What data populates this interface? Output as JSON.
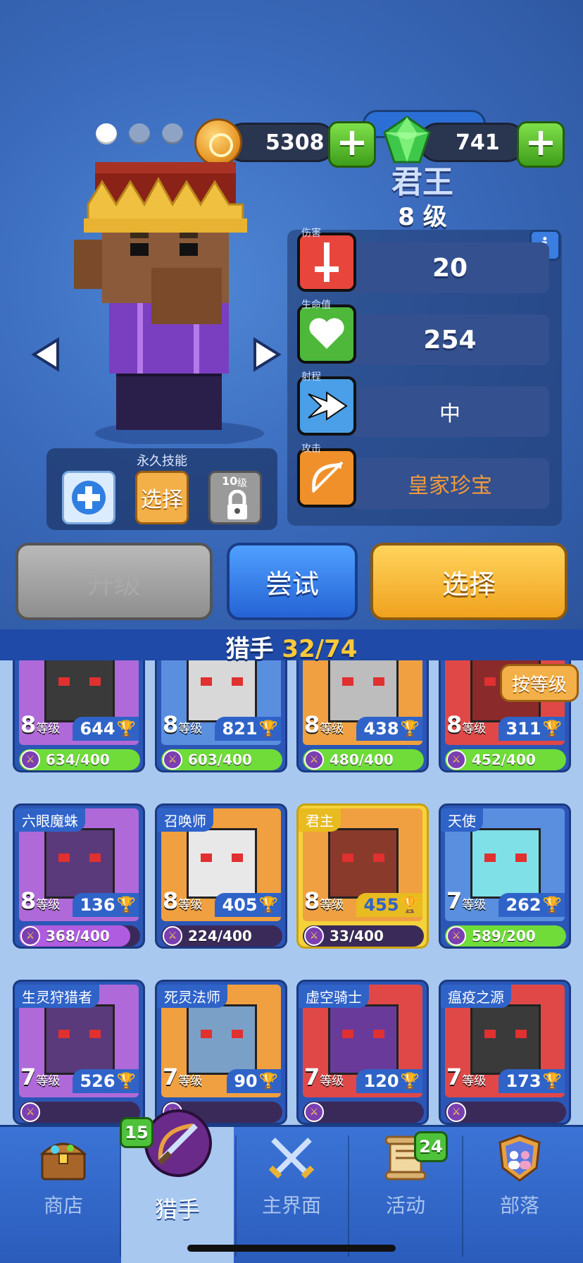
{
  "currency": {
    "coins": "5308",
    "gems": "741",
    "coin_icon": "gold-coin-icon",
    "gem_icon": "green-gem-icon"
  },
  "hero": {
    "name": "君王",
    "level": "8 级"
  },
  "stats": [
    {
      "label": "伤害",
      "value": "20",
      "icon": "sword-icon",
      "color": "#e8453c"
    },
    {
      "label": "生命值",
      "value": "254",
      "icon": "heart-icon",
      "color": "#4db83a"
    },
    {
      "label": "射程",
      "value": "中",
      "icon": "range-arrows-icon",
      "color": "#4a9fe8"
    },
    {
      "label": "攻击",
      "value": "皇家珍宝",
      "icon": "bow-arrow-icon",
      "color": "#f0902a"
    }
  ],
  "permanent_skill": {
    "title": "永久技能",
    "select_label": "选择",
    "locked_level": "10",
    "locked_level_unit": "级"
  },
  "buttons": {
    "upgrade": "升级",
    "try": "尝试",
    "select": "选择"
  },
  "hunters": {
    "title": "猎手",
    "count": "32/74",
    "sort_label": "按等级"
  },
  "cards": [
    {
      "name": "",
      "level": "8",
      "level_unit": "等级",
      "trophies": "644",
      "progress": "634/400",
      "fraction": 1.0,
      "art": "#b069d8",
      "accent": "#3a3a3a"
    },
    {
      "name": "",
      "level": "8",
      "level_unit": "等级",
      "trophies": "821",
      "progress": "603/400",
      "fraction": 1.0,
      "art": "#5a8fe0",
      "accent": "#d8d8d8"
    },
    {
      "name": "",
      "level": "8",
      "level_unit": "等级",
      "trophies": "438",
      "progress": "480/400",
      "fraction": 1.0,
      "art": "#f0a040",
      "accent": "#bdbdbd"
    },
    {
      "name": "",
      "level": "8",
      "level_unit": "等级",
      "trophies": "311",
      "progress": "452/400",
      "fraction": 1.0,
      "art": "#e04848",
      "accent": "#8a2a2a"
    },
    {
      "name": "六眼魔蛛",
      "level": "8",
      "level_unit": "等级",
      "trophies": "136",
      "progress": "368/400",
      "fraction": 0.92,
      "art": "#b069d8",
      "accent": "#5a3a7a"
    },
    {
      "name": "召唤师",
      "level": "8",
      "level_unit": "等级",
      "trophies": "405",
      "progress": "224/400",
      "fraction": 0.0,
      "art": "#f0a040",
      "accent": "#e8e8e8"
    },
    {
      "name": "君主",
      "level": "8",
      "level_unit": "等级",
      "trophies": "455",
      "progress": "33/400",
      "fraction": 0.0,
      "art": "#f0a040",
      "accent": "#8a3a2a",
      "selected": true
    },
    {
      "name": "天使",
      "level": "7",
      "level_unit": "等级",
      "trophies": "262",
      "progress": "589/200",
      "fraction": 1.0,
      "art": "#5a8fe0",
      "accent": "#7fe0e8"
    },
    {
      "name": "生灵狩猎者",
      "level": "7",
      "level_unit": "等级",
      "trophies": "526",
      "progress": "",
      "fraction": 0.0,
      "art": "#b069d8",
      "accent": "#5a3a7a"
    },
    {
      "name": "死灵法师",
      "level": "7",
      "level_unit": "等级",
      "trophies": "90",
      "progress": "",
      "fraction": 0.0,
      "art": "#f0a040",
      "accent": "#7aa0c8"
    },
    {
      "name": "虚空骑士",
      "level": "7",
      "level_unit": "等级",
      "trophies": "120",
      "progress": "",
      "fraction": 0.0,
      "art": "#e04848",
      "accent": "#6a3a9a"
    },
    {
      "name": "瘟疫之源",
      "level": "7",
      "level_unit": "等级",
      "trophies": "173",
      "progress": "",
      "fraction": 0.0,
      "art": "#e04848",
      "accent": "#3a3a3a"
    }
  ],
  "nav": [
    {
      "label": "商店",
      "icon": "treasure-chest-icon",
      "badge": ""
    },
    {
      "label": "猎手",
      "icon": "crossed-sword-bow-icon",
      "badge": "15",
      "active": true
    },
    {
      "label": "主界面",
      "icon": "crossed-swords-icon",
      "badge": ""
    },
    {
      "label": "活动",
      "icon": "scroll-icon",
      "badge": "24"
    },
    {
      "label": "部落",
      "icon": "clan-shield-icon",
      "badge": ""
    }
  ],
  "colors": {
    "accent_blue": "#2f63c8",
    "select_yellow": "#f0a21e",
    "trophy_gold": "#ffcd3a",
    "progress_green": "#6fdc3a"
  }
}
